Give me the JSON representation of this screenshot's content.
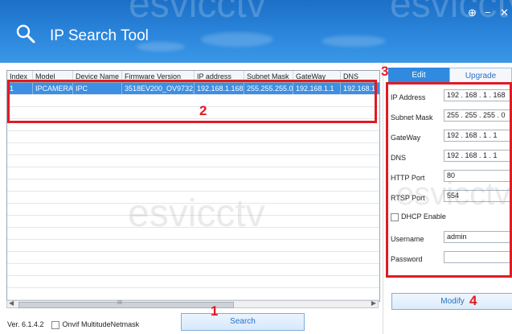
{
  "window": {
    "title": "IP Search Tool",
    "controls": [
      {
        "name": "add-icon",
        "glyph": "⊕"
      },
      {
        "name": "minimize-icon",
        "glyph": "−"
      },
      {
        "name": "close-icon",
        "glyph": "✕"
      }
    ]
  },
  "watermark": "esvicctv",
  "grid": {
    "columns": [
      "Index",
      "Model",
      "Device Name",
      "Firmware Version",
      "IP address",
      "Subnet Mask",
      "GateWay",
      "DNS"
    ],
    "rows": [
      [
        "1",
        "IPCAMERA",
        "IPC",
        "3518EV200_OV9732_...",
        "192.168.1.168",
        "255.255.255.0",
        "192.168.1.1",
        "192.168.1."
      ]
    ],
    "scroll_glyph": "III"
  },
  "footer": {
    "version": "Ver. 6.1.4.2",
    "checkbox_label": "Onvif MultitudeNetmask",
    "search_label": "Search"
  },
  "side": {
    "tabs": [
      "Edit",
      "Upgrade"
    ],
    "fields": [
      {
        "label": "IP Address",
        "value": "192 . 168 . 1 . 168"
      },
      {
        "label": "Subnet Mask",
        "value": "255 . 255 . 255 . 0"
      },
      {
        "label": "GateWay",
        "value": "192 . 168 . 1 . 1"
      },
      {
        "label": "DNS",
        "value": "192 . 168 . 1 . 1"
      },
      {
        "label": "HTTP Port",
        "value": "80"
      },
      {
        "label": "RTSP Port",
        "value": "554"
      }
    ],
    "dhcp_label": "DHCP Enable",
    "username_label": "Username",
    "username_value": "admin",
    "password_label": "Password",
    "password_value": "",
    "modify_label": "Modify"
  },
  "annotations": [
    "1",
    "2",
    "3",
    "4"
  ],
  "colors": {
    "annotation": "#e01b24",
    "header": "#2b86dc",
    "selected_row": "#3c8fe2"
  }
}
